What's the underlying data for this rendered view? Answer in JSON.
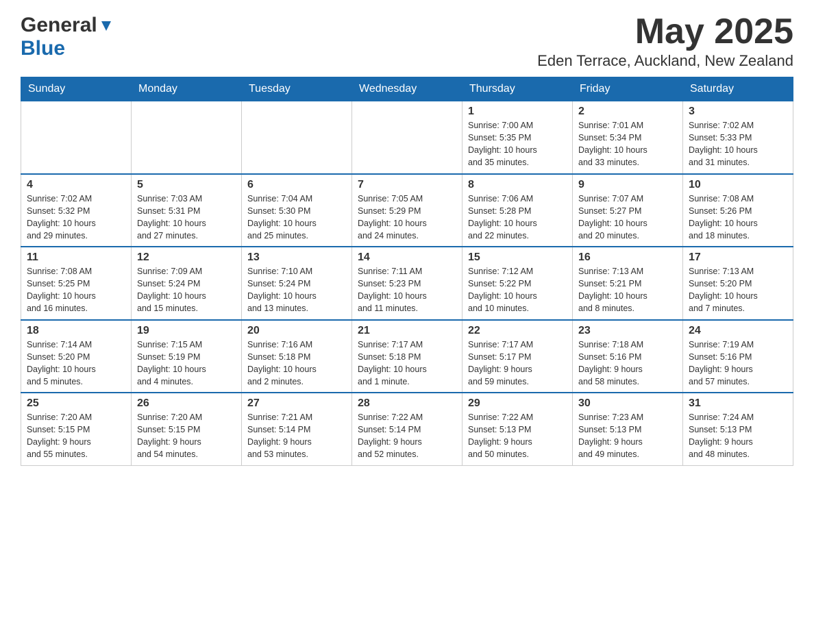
{
  "header": {
    "logo": {
      "general": "General",
      "blue": "Blue"
    },
    "month_title": "May 2025",
    "location": "Eden Terrace, Auckland, New Zealand"
  },
  "days_of_week": [
    "Sunday",
    "Monday",
    "Tuesday",
    "Wednesday",
    "Thursday",
    "Friday",
    "Saturday"
  ],
  "weeks": [
    [
      {
        "day": "",
        "info": ""
      },
      {
        "day": "",
        "info": ""
      },
      {
        "day": "",
        "info": ""
      },
      {
        "day": "",
        "info": ""
      },
      {
        "day": "1",
        "info": "Sunrise: 7:00 AM\nSunset: 5:35 PM\nDaylight: 10 hours\nand 35 minutes."
      },
      {
        "day": "2",
        "info": "Sunrise: 7:01 AM\nSunset: 5:34 PM\nDaylight: 10 hours\nand 33 minutes."
      },
      {
        "day": "3",
        "info": "Sunrise: 7:02 AM\nSunset: 5:33 PM\nDaylight: 10 hours\nand 31 minutes."
      }
    ],
    [
      {
        "day": "4",
        "info": "Sunrise: 7:02 AM\nSunset: 5:32 PM\nDaylight: 10 hours\nand 29 minutes."
      },
      {
        "day": "5",
        "info": "Sunrise: 7:03 AM\nSunset: 5:31 PM\nDaylight: 10 hours\nand 27 minutes."
      },
      {
        "day": "6",
        "info": "Sunrise: 7:04 AM\nSunset: 5:30 PM\nDaylight: 10 hours\nand 25 minutes."
      },
      {
        "day": "7",
        "info": "Sunrise: 7:05 AM\nSunset: 5:29 PM\nDaylight: 10 hours\nand 24 minutes."
      },
      {
        "day": "8",
        "info": "Sunrise: 7:06 AM\nSunset: 5:28 PM\nDaylight: 10 hours\nand 22 minutes."
      },
      {
        "day": "9",
        "info": "Sunrise: 7:07 AM\nSunset: 5:27 PM\nDaylight: 10 hours\nand 20 minutes."
      },
      {
        "day": "10",
        "info": "Sunrise: 7:08 AM\nSunset: 5:26 PM\nDaylight: 10 hours\nand 18 minutes."
      }
    ],
    [
      {
        "day": "11",
        "info": "Sunrise: 7:08 AM\nSunset: 5:25 PM\nDaylight: 10 hours\nand 16 minutes."
      },
      {
        "day": "12",
        "info": "Sunrise: 7:09 AM\nSunset: 5:24 PM\nDaylight: 10 hours\nand 15 minutes."
      },
      {
        "day": "13",
        "info": "Sunrise: 7:10 AM\nSunset: 5:24 PM\nDaylight: 10 hours\nand 13 minutes."
      },
      {
        "day": "14",
        "info": "Sunrise: 7:11 AM\nSunset: 5:23 PM\nDaylight: 10 hours\nand 11 minutes."
      },
      {
        "day": "15",
        "info": "Sunrise: 7:12 AM\nSunset: 5:22 PM\nDaylight: 10 hours\nand 10 minutes."
      },
      {
        "day": "16",
        "info": "Sunrise: 7:13 AM\nSunset: 5:21 PM\nDaylight: 10 hours\nand 8 minutes."
      },
      {
        "day": "17",
        "info": "Sunrise: 7:13 AM\nSunset: 5:20 PM\nDaylight: 10 hours\nand 7 minutes."
      }
    ],
    [
      {
        "day": "18",
        "info": "Sunrise: 7:14 AM\nSunset: 5:20 PM\nDaylight: 10 hours\nand 5 minutes."
      },
      {
        "day": "19",
        "info": "Sunrise: 7:15 AM\nSunset: 5:19 PM\nDaylight: 10 hours\nand 4 minutes."
      },
      {
        "day": "20",
        "info": "Sunrise: 7:16 AM\nSunset: 5:18 PM\nDaylight: 10 hours\nand 2 minutes."
      },
      {
        "day": "21",
        "info": "Sunrise: 7:17 AM\nSunset: 5:18 PM\nDaylight: 10 hours\nand 1 minute."
      },
      {
        "day": "22",
        "info": "Sunrise: 7:17 AM\nSunset: 5:17 PM\nDaylight: 9 hours\nand 59 minutes."
      },
      {
        "day": "23",
        "info": "Sunrise: 7:18 AM\nSunset: 5:16 PM\nDaylight: 9 hours\nand 58 minutes."
      },
      {
        "day": "24",
        "info": "Sunrise: 7:19 AM\nSunset: 5:16 PM\nDaylight: 9 hours\nand 57 minutes."
      }
    ],
    [
      {
        "day": "25",
        "info": "Sunrise: 7:20 AM\nSunset: 5:15 PM\nDaylight: 9 hours\nand 55 minutes."
      },
      {
        "day": "26",
        "info": "Sunrise: 7:20 AM\nSunset: 5:15 PM\nDaylight: 9 hours\nand 54 minutes."
      },
      {
        "day": "27",
        "info": "Sunrise: 7:21 AM\nSunset: 5:14 PM\nDaylight: 9 hours\nand 53 minutes."
      },
      {
        "day": "28",
        "info": "Sunrise: 7:22 AM\nSunset: 5:14 PM\nDaylight: 9 hours\nand 52 minutes."
      },
      {
        "day": "29",
        "info": "Sunrise: 7:22 AM\nSunset: 5:13 PM\nDaylight: 9 hours\nand 50 minutes."
      },
      {
        "day": "30",
        "info": "Sunrise: 7:23 AM\nSunset: 5:13 PM\nDaylight: 9 hours\nand 49 minutes."
      },
      {
        "day": "31",
        "info": "Sunrise: 7:24 AM\nSunset: 5:13 PM\nDaylight: 9 hours\nand 48 minutes."
      }
    ]
  ],
  "colors": {
    "header_bg": "#1a6aad",
    "header_text": "#ffffff",
    "logo_blue": "#1a6aad",
    "logo_general": "#333333",
    "border": "#cccccc",
    "text": "#333333"
  }
}
